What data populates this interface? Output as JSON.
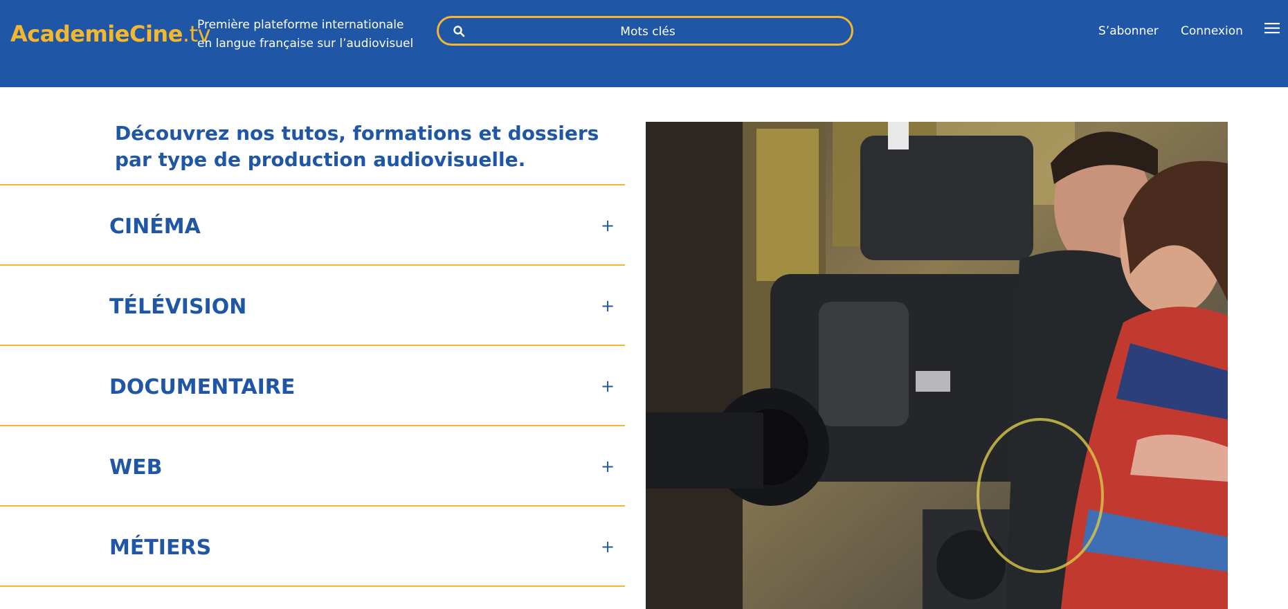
{
  "header": {
    "logo_main": "AcademieCine",
    "logo_tld": ".tv",
    "tagline_line1": "Première plateforme internationale",
    "tagline_line2": "en langue française sur l’audiovisuel",
    "search_placeholder": "Mots clés",
    "subscribe_label": "S’abonner",
    "login_label": "Connexion"
  },
  "main": {
    "heading": "Découvrez nos tutos, formations et dossiers par type de production audiovisuelle.",
    "accordion": [
      {
        "label": "CINÉMA",
        "icon": "plus-icon"
      },
      {
        "label": "TÉLÉVISION",
        "icon": "plus-icon"
      },
      {
        "label": "DOCUMENTAIRE",
        "icon": "plus-icon"
      },
      {
        "label": "WEB",
        "icon": "plus-icon"
      },
      {
        "label": "MÉTIERS",
        "icon": "plus-icon"
      }
    ],
    "plus_symbol": "+"
  },
  "colors": {
    "brand_blue": "#1f56a5",
    "accent_yellow": "#f3b730"
  }
}
